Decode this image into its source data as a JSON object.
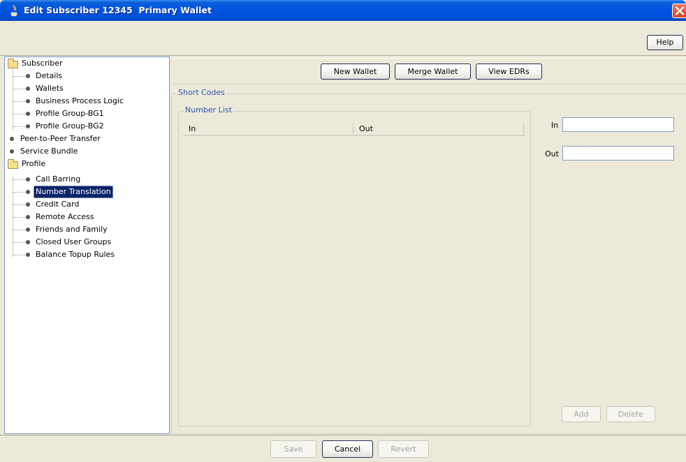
{
  "window": {
    "title": "Edit Subscriber 12345  Primary Wallet",
    "icon": "java-cup-icon",
    "close": "close-icon"
  },
  "toolbar": {
    "help_label": "Help"
  },
  "tree": {
    "items": [
      {
        "label": "Subscriber",
        "icon": "folder-icon"
      },
      {
        "label": "Details"
      },
      {
        "label": "Wallets"
      },
      {
        "label": "Business Process Logic"
      },
      {
        "label": "Profile Group-BG1"
      },
      {
        "label": "Profile Group-BG2"
      },
      {
        "label": "Peer-to-Peer Transfer"
      },
      {
        "label": "Service Bundle"
      },
      {
        "label": "Profile",
        "icon": "folder-icon"
      },
      {
        "label": "Call Barring"
      },
      {
        "label": "Number Translation",
        "selected": true
      },
      {
        "label": "Credit Card"
      },
      {
        "label": "Remote Access"
      },
      {
        "label": "Friends and Family"
      },
      {
        "label": "Closed User Groups"
      },
      {
        "label": "Balance Topup Rules"
      }
    ]
  },
  "actions": {
    "new_wallet": "New Wallet",
    "merge_wallet": "Merge Wallet",
    "view_edrs": "View EDRs"
  },
  "short_codes": {
    "legend": "Short Codes",
    "number_list": {
      "legend": "Number List",
      "columns": [
        "In",
        "Out"
      ]
    },
    "in_label": "In",
    "in_value": "",
    "out_label": "Out",
    "out_value": "",
    "add_label": "Add",
    "delete_label": "Delete"
  },
  "footer": {
    "save_label": "Save",
    "cancel_label": "Cancel",
    "revert_label": "Revert"
  },
  "colors": {
    "titlebar": "#0054e3",
    "selection": "#0a246a",
    "legend": "#2c54b0"
  }
}
